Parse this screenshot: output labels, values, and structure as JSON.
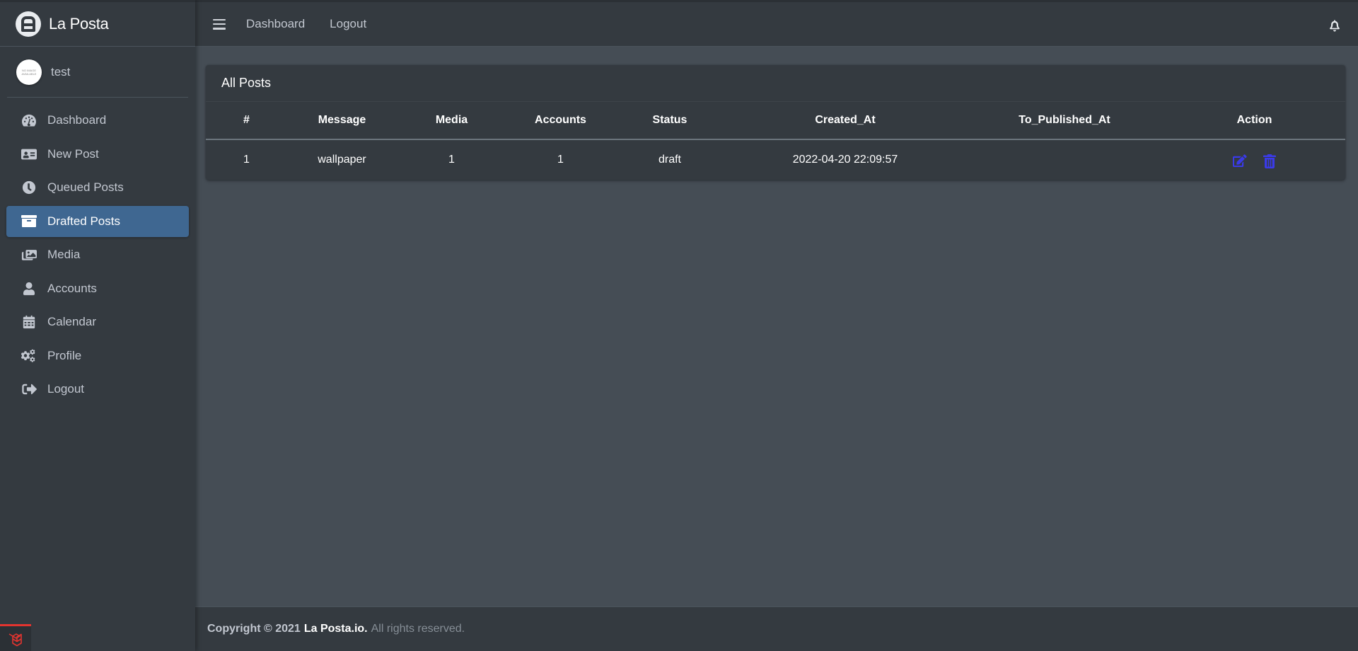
{
  "app": {
    "name": "La Posta"
  },
  "user": {
    "name": "test",
    "avatar_text": "NO IMAGE AVAILABLE"
  },
  "sidebar": {
    "items": [
      {
        "label": "Dashboard",
        "icon": "tachometer-icon",
        "active": false
      },
      {
        "label": "New Post",
        "icon": "id-card-icon",
        "active": false
      },
      {
        "label": "Queued Posts",
        "icon": "clock-icon",
        "active": false
      },
      {
        "label": "Drafted Posts",
        "icon": "archive-icon",
        "active": true
      },
      {
        "label": "Media",
        "icon": "images-icon",
        "active": false
      },
      {
        "label": "Accounts",
        "icon": "user-icon",
        "active": false
      },
      {
        "label": "Calendar",
        "icon": "calendar-icon",
        "active": false
      },
      {
        "label": "Profile",
        "icon": "cogs-icon",
        "active": false
      },
      {
        "label": "Logout",
        "icon": "sign-out-icon",
        "active": false
      }
    ]
  },
  "topbar": {
    "links": [
      "Dashboard",
      "Logout"
    ]
  },
  "card": {
    "title": "All Posts",
    "columns": [
      "#",
      "Message",
      "Media",
      "Accounts",
      "Status",
      "Created_At",
      "To_Published_At",
      "Action"
    ],
    "rows": [
      {
        "id": "1",
        "message": "wallpaper",
        "media": "1",
        "accounts": "1",
        "status": "draft",
        "created_at": "2022-04-20 22:09:57",
        "to_published_at": ""
      }
    ]
  },
  "footer": {
    "copyright": "Copyright © 2021",
    "brand": "La Posta.io.",
    "rights": "All rights reserved."
  },
  "colors": {
    "sidebar_bg": "#343a40",
    "content_bg": "#454d55",
    "active_item": "#3f6791",
    "action_icon": "#3a3ae8"
  }
}
